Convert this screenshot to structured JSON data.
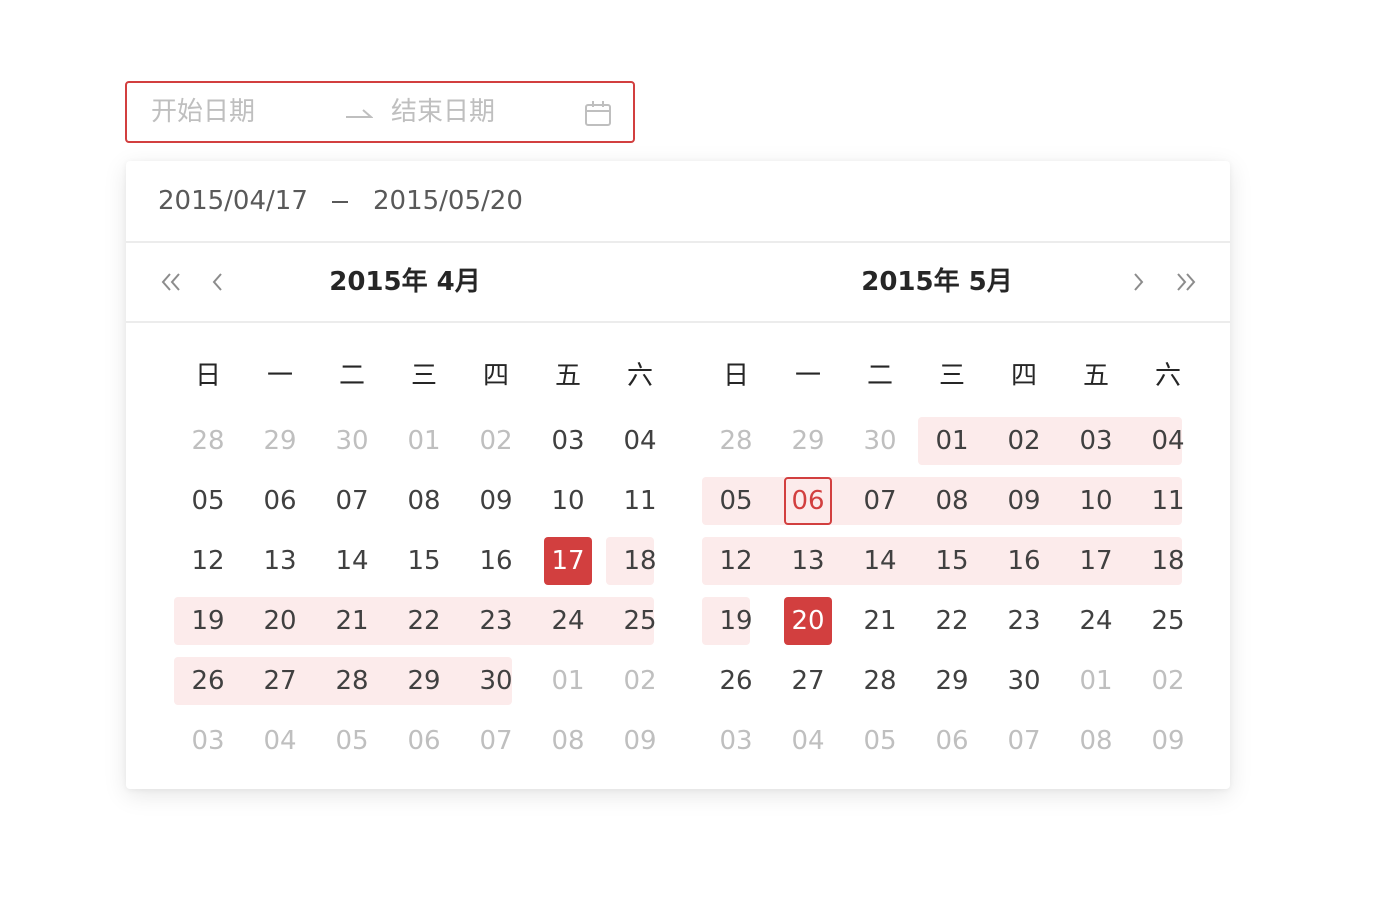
{
  "input": {
    "start_placeholder": "开始日期",
    "end_placeholder": "结束日期",
    "icons": [
      "arrow-right-icon",
      "calendar-icon"
    ]
  },
  "panel": {
    "selected_start": "2015/04/17",
    "selected_end": "2015/05/20",
    "left_title": "2015年 4月",
    "right_title": "2015年 5月",
    "nav_icons": [
      "double-chevron-left-icon",
      "chevron-left-icon",
      "chevron-right-icon",
      "double-chevron-right-icon"
    ]
  },
  "weekdays": [
    "日",
    "一",
    "二",
    "三",
    "四",
    "五",
    "六"
  ],
  "left_month": {
    "rows": [
      [
        "28",
        "29",
        "30",
        "01",
        "02",
        "03",
        "04"
      ],
      [
        "05",
        "06",
        "07",
        "08",
        "09",
        "10",
        "11"
      ],
      [
        "12",
        "13",
        "14",
        "15",
        "16",
        "17",
        "18"
      ],
      [
        "19",
        "20",
        "21",
        "22",
        "23",
        "24",
        "25"
      ],
      [
        "26",
        "27",
        "28",
        "29",
        "30",
        "01",
        "02"
      ],
      [
        "03",
        "04",
        "05",
        "06",
        "07",
        "08",
        "09"
      ]
    ]
  },
  "right_month": {
    "rows": [
      [
        "28",
        "29",
        "30",
        "01",
        "02",
        "03",
        "04"
      ],
      [
        "05",
        "06",
        "07",
        "08",
        "09",
        "10",
        "11"
      ],
      [
        "12",
        "13",
        "14",
        "15",
        "16",
        "17",
        "18"
      ],
      [
        "19",
        "20",
        "21",
        "22",
        "23",
        "24",
        "25"
      ],
      [
        "26",
        "27",
        "28",
        "29",
        "30",
        "01",
        "02"
      ],
      [
        "03",
        "04",
        "05",
        "06",
        "07",
        "08",
        "09"
      ]
    ]
  },
  "colors": {
    "accent": "#d23f3f",
    "range_bg": "#fcebeb",
    "muted_text": "#bfbfbf"
  }
}
